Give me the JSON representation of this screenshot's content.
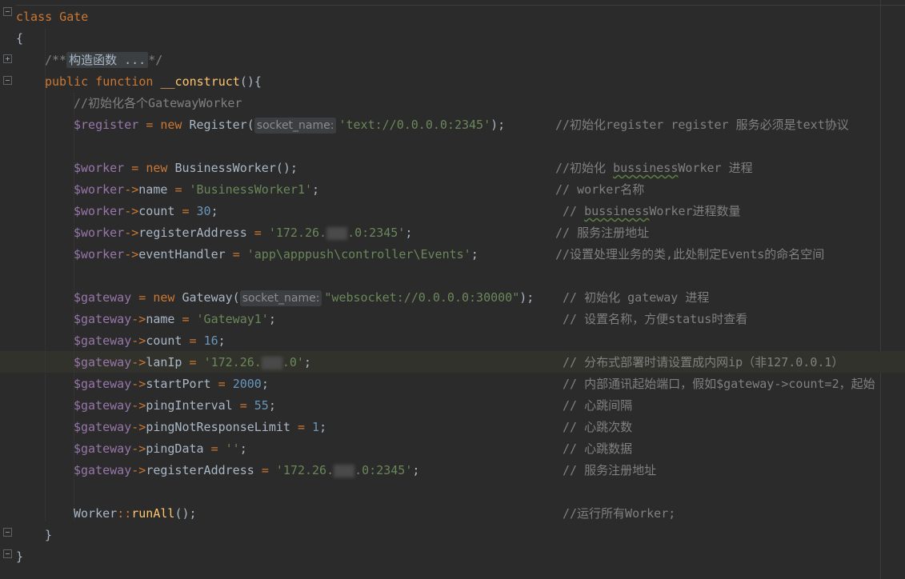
{
  "code": {
    "class_decl": "class Gate",
    "open_brace": "{",
    "doc_comment_start": "/**",
    "doc_comment_folded": "构造函数 ...",
    "doc_comment_end": "*/",
    "kw_public": "public",
    "kw_function": "function",
    "method_name": "__construct",
    "method_tail": "(){",
    "comment_init_workers": "//初始化各个GatewayWorker",
    "register_var": "$register",
    "kw_new": "new",
    "register_class": "Register(",
    "register_hint": "socket_name:",
    "register_arg": "'text://0.0.0.0:2345'",
    "register_close": ");",
    "register_comment": "//初始化register register 服务必须是text协议",
    "worker_var": "$worker",
    "worker_class": "BusinessWorker();",
    "worker_comment_a": "//初始化 ",
    "worker_comment_b": "bussiness",
    "worker_comment_c": "Worker 进程",
    "worker_name_prop": "name",
    "worker_name_val": "'BusinessWorker1'",
    "worker_name_comment": "// worker名称",
    "worker_count_prop": "count",
    "worker_count_val": "30",
    "worker_count_comment_a": "// ",
    "worker_count_comment_b": "bussiness",
    "worker_count_comment_c": "Worker进程数量",
    "worker_reg_prop": "registerAddress",
    "worker_reg_val_a": "'172.26.",
    "worker_reg_val_b": ".0:2345'",
    "worker_reg_comment": "// 服务注册地址",
    "worker_evt_prop": "eventHandler",
    "worker_evt_val": "'app\\apppush\\controller\\Events'",
    "worker_evt_comment": "//设置处理业务的类,此处制定Events的命名空间",
    "gw_var": "$gateway",
    "gw_class": "Gateway(",
    "gw_hint": "socket_name:",
    "gw_arg": "\"websocket://0.0.0.0:30000\"",
    "gw_close": ");",
    "gw_comment": "// 初始化 gateway 进程",
    "gw_name_prop": "name",
    "gw_name_val": "'Gateway1'",
    "gw_name_comment": "// 设置名称，方便status时查看",
    "gw_count_prop": "count",
    "gw_count_val": "16",
    "gw_lan_prop": "lanIp",
    "gw_lan_val_a": "'172.26.",
    "gw_lan_val_b": ".0'",
    "gw_lan_comment": "// 分布式部署时请设置成内网ip（非127.0.0.1）",
    "gw_port_prop": "startPort",
    "gw_port_val": "2000",
    "gw_port_comment": "// 内部通讯起始端口，假如$gateway->count=2，起始",
    "gw_ping_prop": "pingInterval",
    "gw_ping_val": "55",
    "gw_ping_comment": "// 心跳间隔",
    "gw_pnr_prop": "pingNotResponseLimit",
    "gw_pnr_val": "1",
    "gw_pnr_comment": "// 心跳次数",
    "gw_pdata_prop": "pingData",
    "gw_pdata_val": "''",
    "gw_pdata_comment": "// 心跳数据",
    "gw_reg_prop": "registerAddress",
    "gw_reg_val_a": "'172.26.",
    "gw_reg_val_b": ".0:2345'",
    "gw_reg_comment": "// 服务注册地址",
    "run_class": "Worker",
    "run_sep": "::",
    "run_fn": "runAll",
    "run_tail": "();",
    "run_comment": "//运行所有Worker;",
    "close_method": "}",
    "close_class": "}"
  },
  "colors": {
    "background": "#2b2b2b",
    "keyword": "#cc7832",
    "variable": "#9876aa",
    "number": "#6897bb",
    "string": "#6a8759",
    "comment": "#808080",
    "function": "#ffc66d",
    "text": "#a9b7c6"
  }
}
